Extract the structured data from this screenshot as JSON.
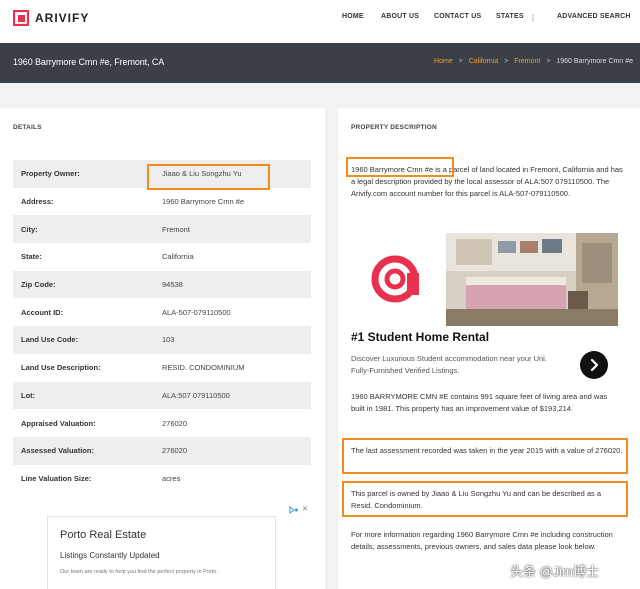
{
  "brand": {
    "name": "ARIVIFY",
    "color": "#e8314f"
  },
  "nav": {
    "home": "HOME",
    "about": "ABOUT US",
    "contact": "CONTACT US",
    "states": "STATES",
    "separator": "|",
    "advanced": "ADVANCED SEARCH"
  },
  "header": {
    "title": "1960 Barrymore Cmn #e, Fremont, CA",
    "breadcrumbs": [
      "Home",
      "California",
      "Fremont",
      "1960 Barrymore Cmn #e"
    ],
    "crumb_separator": ">"
  },
  "details": {
    "heading": "DETAILS",
    "rows": [
      {
        "key": "Property Owner:",
        "value": "Jiaao & Liu Songzhu Yu"
      },
      {
        "key": "Address:",
        "value": "1960 Barrymore Cmn #e"
      },
      {
        "key": "City:",
        "value": "Fremont"
      },
      {
        "key": "State:",
        "value": "California"
      },
      {
        "key": "Zip Code:",
        "value": "94538"
      },
      {
        "key": "Account ID:",
        "value": "ALA-507-079110500"
      },
      {
        "key": "Land Use Code:",
        "value": "103"
      },
      {
        "key": "Land Use Description:",
        "value": "RESID. CONDOMINIUM"
      },
      {
        "key": "Lot:",
        "value": "ALA:507 079110500"
      },
      {
        "key": "Appraised Valuation:",
        "value": "276020"
      },
      {
        "key": "Assessed Valuation:",
        "value": "276020"
      },
      {
        "key": "Line Valuation Size:",
        "value": "acres"
      }
    ]
  },
  "ad_left": {
    "title": "Porto Real Estate",
    "subtitle": "Listings Constantly Updated",
    "desc": "Our team are ready to help you find the perfect property in Porto.",
    "close": "✕"
  },
  "description": {
    "heading": "PROPERTY DESCRIPTION",
    "p1": "1960 Barrymore Cmn #e is a parcel of land located in Fremont, California and has a legal description provided by the local assessor of ALA:507 079110500. The Arivify.com account number for this parcel is ALA-507-079110500.",
    "p2": "1960 BARRYMORE CMN #E contains 991 square feet of living area and was built in 1981. This property has an improvement value of $193,214.",
    "p3": "The last assessment recorded was taken in the year 2015 with a value of 276020.",
    "p4": "This parcel is owned by Jiaao & Liu Songzhu Yu and can be described as a Resid. Condominium.",
    "p5": "For more information regarding 1960 Barrymore Cmn #e including construction details, assessments, previous owners, and sales data please look below."
  },
  "ad_right": {
    "title": "#1 Student Home Rental",
    "subtitle": "Discover Luxurious Student accommodation near your Uni. Fully-Furnished Verified Listings."
  },
  "watermark": "头条 @Jim博士",
  "colors": {
    "accent": "#f39a2b",
    "highlight": "#f08c1e",
    "titlebar": "#3a3f48"
  }
}
